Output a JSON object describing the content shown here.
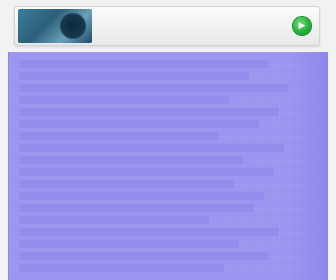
{
  "banner": {
    "title": "",
    "subtitle": "",
    "go_icon": "arrow-right-icon",
    "thumb_icon": "ad-thumbnail-image"
  },
  "panel": {
    "background": "#9b96f0",
    "lines": []
  },
  "colors": {
    "go_button": "#24b23a",
    "panel": "#9b96f0"
  }
}
